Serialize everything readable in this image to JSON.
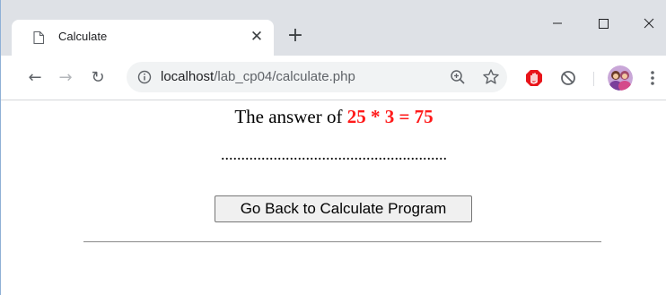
{
  "browser": {
    "tab": {
      "title": "Calculate",
      "close_glyph": "✕",
      "icon": "page-icon"
    },
    "new_tab_glyph": "+",
    "window_controls": {
      "minimize": "—",
      "maximize": "☐",
      "close": "✕"
    },
    "toolbar": {
      "back_glyph": "←",
      "forward_glyph": "→",
      "reload_glyph": "↻",
      "url_host": "localhost",
      "url_path": "/lab_cp04/calculate.php",
      "icons": [
        "info-icon",
        "zoom-icon",
        "star-icon",
        "adblock-stop-icon",
        "block-icon",
        "avatar",
        "kebab-menu-icon"
      ]
    }
  },
  "page": {
    "answer_prefix": "The answer of ",
    "answer_expression": "25 * 3 = 75",
    "dotted_line": "........................................................",
    "back_button_label": "Go Back to Calculate Program"
  },
  "colors": {
    "answer_highlight": "#ff1a1a",
    "tabstrip": "#dee1e6",
    "omnibox": "#f1f3f4"
  }
}
